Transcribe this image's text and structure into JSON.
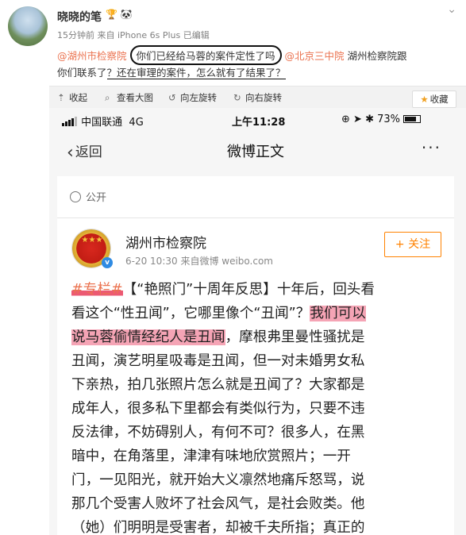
{
  "post": {
    "username": "晓晓的笔",
    "badges": "🏆 🐼",
    "meta": "15分钟前 来自 iPhone 6s Plus   已编辑",
    "mention1": "@湖州市检察院",
    "circled_text": "你们已经给马蓉的案件定性了吗",
    "mention2": "@北京三中院",
    "line1_tail": " 湖州检察院跟",
    "line2_prefix": "你们联系了",
    "underlined_text": "？还在审理的案件，怎么就有了结果了？"
  },
  "toolbar": {
    "collapse": "收起",
    "view_large": "查看大图",
    "rotate_left": "向左旋转",
    "rotate_right": "向右旋转",
    "favorite": "收藏"
  },
  "screenshot": {
    "status": {
      "carrier": "中国联通",
      "network": "4G",
      "time": "上午11:28",
      "battery": "73%"
    },
    "nav": {
      "back": "返回",
      "title": "微博正文"
    },
    "visibility": "公开",
    "account": {
      "name": "湖州市检察院",
      "meta": "6-20 10:30  来自微博 weibo.com",
      "follow": "+ 关注"
    },
    "text": {
      "l1_tag": "#专栏#",
      "l1_rest": "【“艳照门”十周年反思】十年后，回头看",
      "l2_a": "看这个“性丑闻”，它哪里像个“丑闻”？",
      "l2_hl": "我们可以",
      "l3_hl": "说马蓉偷情经纪人是丑闻",
      "l3_rest": "，摩根弗里曼性骚扰是",
      "l4": "丑闻，演艺明星吸毒是丑闻，但一对未婚男女私",
      "l5": "下亲热，拍几张照片怎么就是丑闻了？大家都是",
      "l6": "成年人，很多私下里都会有类似行为，只要不违",
      "l7": "反法律，不妨碍别人，有何不可？很多人，在黑",
      "l8": "暗中，在角落里，津津有味地欣赏照片；一开",
      "l9": "门，一见阳光，就开始大义凛然地痛斥怒骂，说",
      "l10": "那几个受害人败坏了社会风气，是社会败类。他",
      "l11": "（她）们明明是受害者，却被千夫所指；真正的"
    }
  }
}
